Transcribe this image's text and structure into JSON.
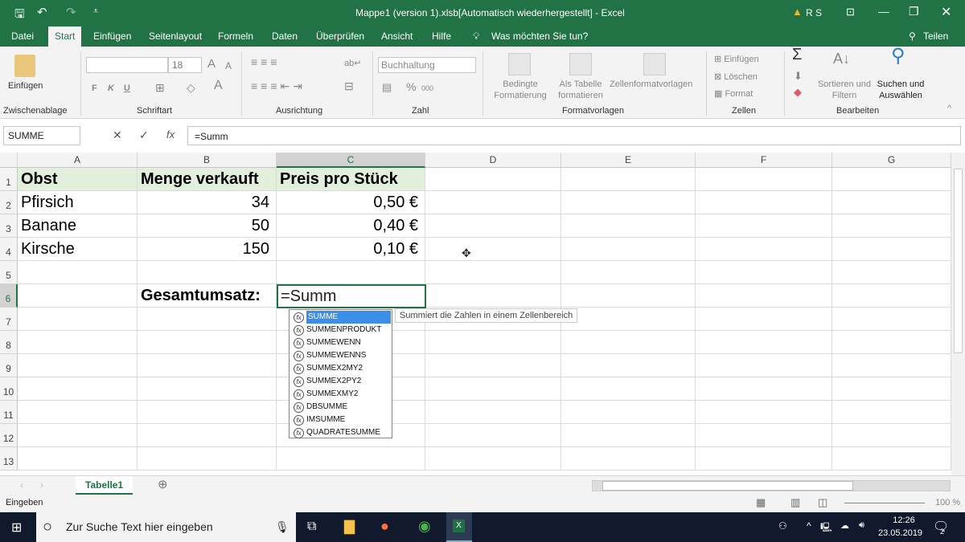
{
  "title_bar": {
    "title": "Mappe1 (version 1).xlsb[Automatisch wiederhergestellt]  -  Excel",
    "user": "R S",
    "warning_icon": "warning-icon"
  },
  "ribbon_tabs": [
    "Datei",
    "Start",
    "Einfügen",
    "Seitenlayout",
    "Formeln",
    "Daten",
    "Überprüfen",
    "Ansicht",
    "Hilfe"
  ],
  "tell_me": "Was möchten Sie tun?",
  "share": "Teilen",
  "ribbon": {
    "clipboard": {
      "paste": "Einfügen",
      "group": "Zwischenablage"
    },
    "font": {
      "name": "",
      "size": "18",
      "bold": "F",
      "italic": "K",
      "underline": "U",
      "font_color": "A",
      "group": "Schriftart"
    },
    "alignment": {
      "group": "Ausrichtung"
    },
    "number": {
      "format": "Buchhaltung",
      "percent": "%",
      "thousands": "000",
      "group": "Zahl"
    },
    "styles": {
      "conditional": "Bedingte Formatierung",
      "as_table": "Als Tabelle formatieren",
      "cell_styles": "Zellenformatvorlagen",
      "group": "Formatvorlagen"
    },
    "cells": {
      "insert": "Einfügen",
      "delete": "Löschen",
      "format": "Format",
      "group": "Zellen"
    },
    "editing": {
      "sort": "Sortieren und Filtern",
      "find": "Suchen und Auswählen",
      "group": "Bearbeiten"
    }
  },
  "formula_bar": {
    "name_box": "SUMME",
    "formula": "=Summ"
  },
  "columns": [
    "A",
    "B",
    "C",
    "D",
    "E",
    "F",
    "G"
  ],
  "rows": [
    "1",
    "2",
    "3",
    "4",
    "5",
    "6",
    "7",
    "8",
    "9",
    "10",
    "11",
    "12",
    "13"
  ],
  "cells": [
    [
      "Obst",
      "Menge verkauft",
      "Preis pro Stück"
    ],
    [
      "Pfirsich",
      "34",
      "0,50 €"
    ],
    [
      "Banane",
      "50",
      "0,40 €"
    ],
    [
      "Kirsche",
      "150",
      "0,10 €"
    ],
    [
      "",
      "",
      ""
    ],
    [
      "",
      "Gesamtumsatz:",
      ""
    ]
  ],
  "active_cell": {
    "ref": "C6",
    "value": "=Summ"
  },
  "autocomplete": [
    "SUMME",
    "SUMMENPRODUKT",
    "SUMMEWENN",
    "SUMMEWENNS",
    "SUMMEX2MY2",
    "SUMMEX2PY2",
    "SUMMEXMY2",
    "DBSUMME",
    "IMSUMME",
    "QUADRATESUMME"
  ],
  "tooltip": "Summiert die Zahlen in einem Zellenbereich",
  "sheets": [
    "Tabelle1"
  ],
  "status": {
    "mode": "Eingeben",
    "zoom": "100 %"
  },
  "taskbar": {
    "search_placeholder": "Zur Suche Text hier eingeben",
    "time": "12:26",
    "date": "23.05.2019",
    "notifications": "2"
  },
  "colors": {
    "accent": "#217346",
    "header_fill": "#e2efda",
    "selection": "#3b8fe6"
  }
}
